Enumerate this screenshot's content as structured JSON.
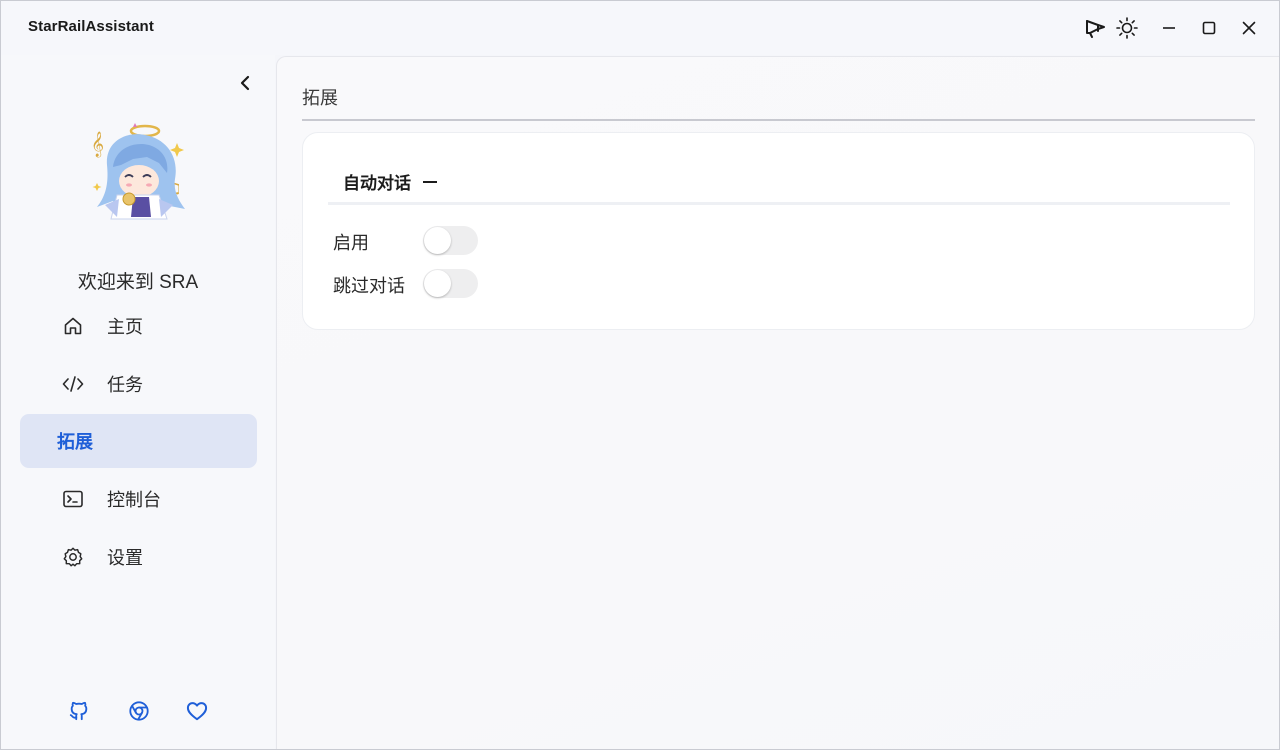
{
  "app": {
    "title": "StarRailAssistant"
  },
  "titlebar": {
    "icons": [
      "announcement-icon",
      "theme-sun-icon",
      "minimize-icon",
      "maximize-icon",
      "close-icon"
    ]
  },
  "sidebar": {
    "welcome": "欢迎来到 SRA",
    "items": [
      {
        "label": "主页",
        "icon": "home-icon",
        "active": false
      },
      {
        "label": "任务",
        "icon": "code-icon",
        "active": false
      },
      {
        "label": "拓展",
        "icon": "",
        "active": true
      },
      {
        "label": "控制台",
        "icon": "terminal-icon",
        "active": false
      },
      {
        "label": "设置",
        "icon": "gear-icon",
        "active": false
      }
    ],
    "footer_icons": [
      "github-icon",
      "chrome-icon",
      "heart-icon"
    ]
  },
  "main": {
    "page_title": "拓展",
    "card": {
      "header": "自动对话",
      "options": [
        {
          "label": "启用",
          "enabled": false
        },
        {
          "label": "跳过对话",
          "enabled": false
        }
      ]
    }
  },
  "colors": {
    "accent": "#1f5fd8",
    "active_nav_bg": "#dfe5f5",
    "window_bg": "#f5f6fa"
  }
}
